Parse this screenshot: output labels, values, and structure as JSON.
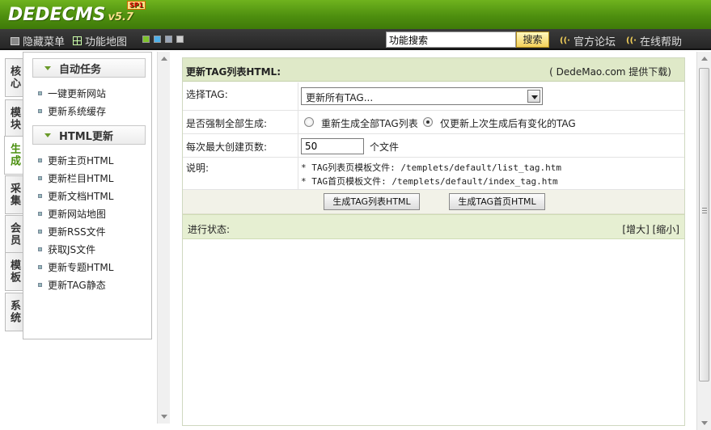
{
  "header": {
    "logo_text": "DEDECMS",
    "version": "v5.7",
    "sp_badge": "SP1"
  },
  "menubar": {
    "hide_menu": "隐藏菜单",
    "function_map": "功能地图",
    "swatches": [
      "#7ec22d",
      "#4fb0e8",
      "#9aa6b8",
      "#cfcfcf"
    ],
    "search_value": "功能搜索",
    "search_button": "搜索",
    "forum": "官方论坛",
    "help": "在线帮助"
  },
  "vtabs": [
    {
      "label": "核心",
      "active": false
    },
    {
      "label": "模块",
      "active": false
    },
    {
      "label": "生成",
      "active": true
    },
    {
      "label": "采集",
      "active": false
    },
    {
      "label": "会员",
      "active": false
    },
    {
      "label": "模板",
      "active": false
    },
    {
      "label": "系统",
      "active": false
    }
  ],
  "left_menu": {
    "section1": {
      "title": "自动任务",
      "items": [
        "一键更新网站",
        "更新系统缓存"
      ]
    },
    "section2": {
      "title": "HTML更新",
      "items": [
        "更新主页HTML",
        "更新栏目HTML",
        "更新文档HTML",
        "更新网站地图",
        "更新RSS文件",
        "获取JS文件",
        "更新专题HTML",
        "更新TAG静态"
      ]
    }
  },
  "main": {
    "title": "更新TAG列表HTML:",
    "credit": "( DedeMao.com 提供下载)",
    "select_tag_label": "选择TAG:",
    "select_tag_value": "更新所有TAG...",
    "force_label": "是否强制全部生成:",
    "radio_all": "重新生成全部TAG列表",
    "radio_changed": "仅更新上次生成后有变化的TAG",
    "max_pages_label": "每次最大创建页数:",
    "max_pages_value": "50",
    "max_pages_unit": "个文件",
    "note_label": "说明:",
    "note_line1": "* TAG列表页模板文件: /templets/default/list_tag.htm",
    "note_line2": "* TAG首页模板文件: /templets/default/index_tag.htm",
    "btn_list": "生成TAG列表HTML",
    "btn_index": "生成TAG首页HTML",
    "status_label": "进行状态:",
    "enlarge": "[增大]",
    "shrink": "[缩小]"
  }
}
